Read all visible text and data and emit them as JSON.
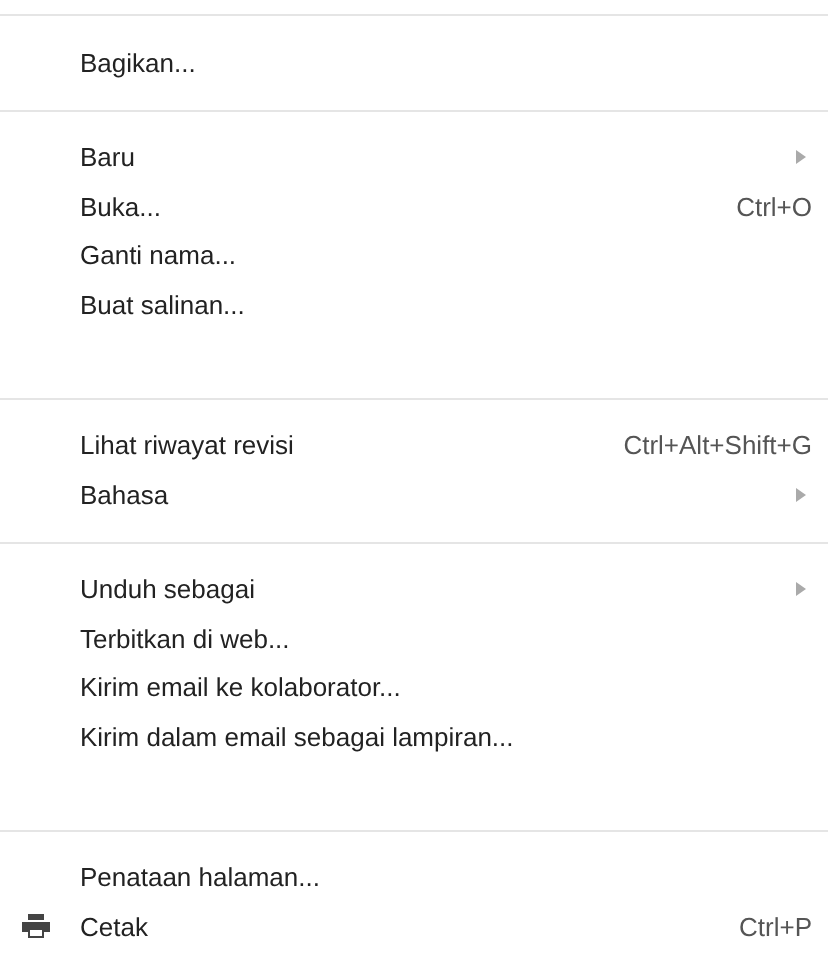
{
  "menu": {
    "sections": [
      {
        "items": [
          {
            "kind": "action",
            "label": "Bagikan..."
          }
        ]
      },
      {
        "items": [
          {
            "kind": "submenu",
            "label": "Baru"
          },
          {
            "kind": "action",
            "label": "Buka...",
            "shortcut": "Ctrl+O"
          },
          {
            "kind": "action",
            "label": "Ganti nama..."
          },
          {
            "kind": "action",
            "label": "Buat salinan..."
          }
        ]
      },
      {
        "items": [
          {
            "kind": "action",
            "label": "Lihat riwayat revisi",
            "shortcut": "Ctrl+Alt+Shift+G"
          },
          {
            "kind": "submenu",
            "label": "Bahasa"
          }
        ]
      },
      {
        "items": [
          {
            "kind": "submenu",
            "label": "Unduh sebagai"
          },
          {
            "kind": "action",
            "label": "Terbitkan di web..."
          },
          {
            "kind": "action",
            "label": "Kirim email ke kolaborator..."
          },
          {
            "kind": "action",
            "label": "Kirim dalam email sebagai lampiran..."
          }
        ]
      },
      {
        "items": [
          {
            "kind": "action",
            "label": "Penataan halaman..."
          },
          {
            "kind": "print",
            "label": "Cetak",
            "shortcut": "Ctrl+P"
          }
        ]
      }
    ]
  }
}
